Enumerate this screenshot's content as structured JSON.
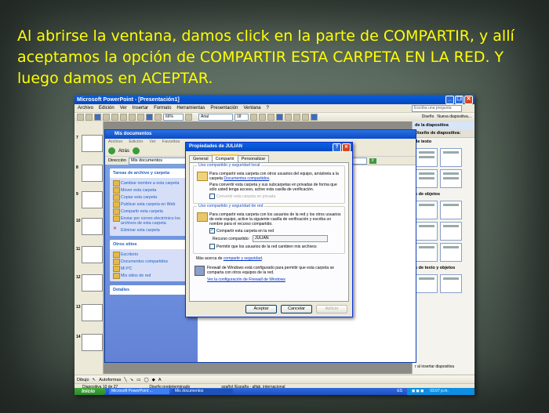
{
  "caption": "Al abrirse la ventana, damos click en la parte de COMPARTIR, y allí aceptamos la opción de COMPARTIR ESTA CARPETA EN LA RED. Y luego damos en ACEPTAR.",
  "colors": {
    "caption": "#ffff00",
    "xp_blue": "#0a5fd8",
    "taskpane_bg": "#f4f3ee"
  },
  "powerpoint": {
    "title": "Microsoft PowerPoint - [Presentación1]",
    "menu": [
      "Archivo",
      "Edición",
      "Ver",
      "Insertar",
      "Formato",
      "Herramientas",
      "Presentación",
      "Ventana",
      "?"
    ],
    "help_placeholder": "Escriba una pregunta",
    "zoom": "66%",
    "font": "Arial",
    "font_size": "18",
    "design_label": "Diseño",
    "new_slide_label": "Nueva diapositiva...",
    "slide_numbers": [
      "7",
      "8",
      "9",
      "10",
      "11",
      "12",
      "13",
      "14"
    ],
    "drawing_label": "Dibujo",
    "autoshapes_label": "Autoformas",
    "status": {
      "slide": "Diapositiva 10 de 27",
      "design": "Diseño predeterminado",
      "language": "spañol (España - alfab. internacional"
    },
    "taskpane": {
      "title": "de la diapositiva",
      "section1": "Diseño de diapositiva:",
      "text_layouts": "de texto",
      "object_layouts": "s de objetos",
      "text_and_objects": "s de texto y objetos",
      "insert_note": "r al insertar diapositiva"
    }
  },
  "mydocs": {
    "title": "Mis documentos",
    "menu": [
      "Archivo",
      "Edición",
      "Ver",
      "Favoritos"
    ],
    "back": "Atrás",
    "address_label": "Dirección",
    "address": "Mis documentos",
    "go": "Ir",
    "file_tasks_title": "Tareas de archivo y carpeta",
    "file_tasks": [
      "Cambiar nombre a esta carpeta",
      "Mover esta carpeta",
      "Copiar esta carpeta",
      "Publicar esta carpeta en Web",
      "Compartir esta carpeta",
      "Enviar por correo electrónico los archivos de esta carpeta",
      "Eliminar esta carpeta"
    ],
    "other_places_title": "Otros sitios",
    "other_places": [
      "Escritorio",
      "Documentos compartidos",
      "Mi PC",
      "Mis sitios de red"
    ],
    "details_title": "Detalles"
  },
  "dialog": {
    "title": "Propiedades de JULIAN",
    "tabs": [
      "General",
      "Compartir",
      "Personalizar"
    ],
    "local_group": "Uso compartido y seguridad local",
    "local_text1_pre": "Para compartir esta carpeta con otros usuarios del equipo, arrástrela a la carpeta ",
    "local_link": "Documentos compartidos",
    "local_text2": "Para convertir esta carpeta y sus subcarpetas en privadas de forma que sólo usted tenga acceso, active esta casilla de verificación.",
    "private_check": "Convertir esta carpeta en privada",
    "net_group": "Uso compartido y seguridad de red",
    "net_text": "Para compartir esta carpeta con los usuarios de la red y los otros usuarios de este equipo, active la siguiente casilla de verificación y escriba un nombre para el recurso compartido.",
    "share_check": "Compartir esta carpeta en la red",
    "share_name_label": "Recurso compartido:",
    "share_name_value": "JULIAN",
    "change_check": "Permitir que los usuarios de la red cambien mis archivos",
    "more_info_pre": "Más acerca de ",
    "more_info_link": "compartir y seguridad",
    "firewall_text": "Firewall de Windows está configurado para permitir que esta carpeta se comparta con otros equipos de la red.",
    "firewall_link": "Ver la configuración de Firewall de Windows",
    "ok": "Aceptar",
    "cancel": "Cancelar",
    "apply": "Aplicar"
  },
  "taskbar": {
    "start": "Inicio",
    "items": [
      "Microsoft PowerPoint ...",
      "Mis documentos"
    ],
    "lang": "ES",
    "time": "03:07 p.m."
  }
}
